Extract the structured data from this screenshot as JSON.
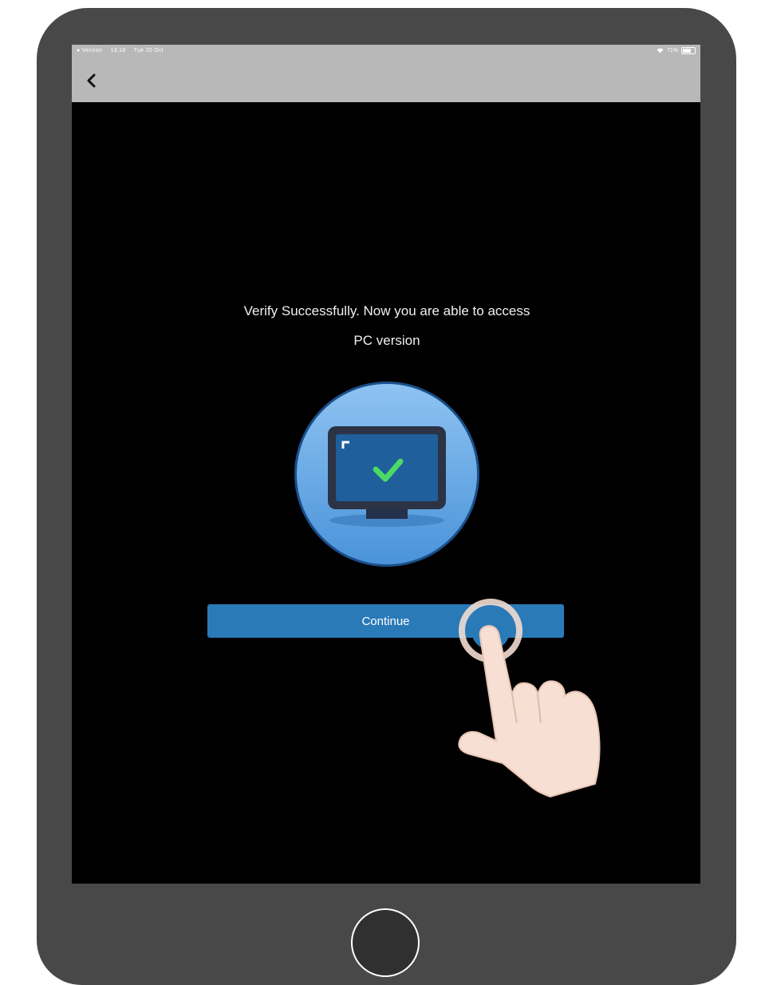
{
  "status_bar": {
    "carrier": "● Verizon",
    "time": "13:18",
    "date": "Tue 20 Oct",
    "battery": "71%"
  },
  "screen": {
    "message_line1": "Verify Successfully. Now you are able to access",
    "message_line2": "PC version",
    "continue_label": "Continue"
  },
  "colors": {
    "button": "#2a7ab8",
    "device_frame": "#484848",
    "nav_bar": "#b8b8b8",
    "check": "#4cd964"
  },
  "icons": {
    "back": "chevron-left-icon",
    "illustration": "monitor-check-icon",
    "hand": "tap-hand-icon"
  }
}
